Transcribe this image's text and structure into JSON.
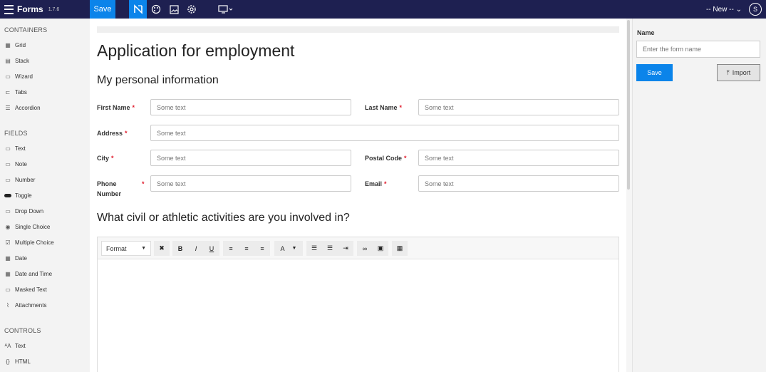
{
  "app": {
    "name": "Forms",
    "version": "1.7.6"
  },
  "topbar": {
    "save_label": "Save",
    "form_selector": "-- New --",
    "avatar_initial": "S"
  },
  "sidebar": {
    "containers_title": "CONTAINERS",
    "containers": [
      {
        "label": "Grid",
        "icon": "grid-icon"
      },
      {
        "label": "Stack",
        "icon": "stack-icon"
      },
      {
        "label": "Wizard",
        "icon": "wizard-icon"
      },
      {
        "label": "Tabs",
        "icon": "tabs-icon"
      },
      {
        "label": "Accordion",
        "icon": "accordion-icon"
      }
    ],
    "fields_title": "FIELDS",
    "fields": [
      {
        "label": "Text",
        "icon": "text-field-icon"
      },
      {
        "label": "Note",
        "icon": "note-icon"
      },
      {
        "label": "Number",
        "icon": "number-icon"
      },
      {
        "label": "Toggle",
        "icon": "toggle-icon"
      },
      {
        "label": "Drop Down",
        "icon": "dropdown-icon"
      },
      {
        "label": "Single Choice",
        "icon": "radio-icon"
      },
      {
        "label": "Multiple Choice",
        "icon": "checkbox-icon"
      },
      {
        "label": "Date",
        "icon": "calendar-icon"
      },
      {
        "label": "Date and Time",
        "icon": "datetime-icon"
      },
      {
        "label": "Masked Text",
        "icon": "masked-text-icon"
      },
      {
        "label": "Attachments",
        "icon": "paperclip-icon"
      }
    ],
    "controls_title": "CONTROLS",
    "controls": [
      {
        "label": "Text",
        "icon": "text-control-icon"
      },
      {
        "label": "HTML",
        "icon": "html-icon"
      }
    ]
  },
  "form": {
    "title": "Application for employment",
    "section1": "My personal information",
    "fields": {
      "first_name": {
        "label": "First Name",
        "placeholder": "Some text"
      },
      "last_name": {
        "label": "Last Name",
        "placeholder": "Some text"
      },
      "address": {
        "label": "Address",
        "placeholder": "Some text"
      },
      "city": {
        "label": "City",
        "placeholder": "Some text"
      },
      "postal_code": {
        "label": "Postal Code",
        "placeholder": "Some text"
      },
      "phone_line1": "Phone",
      "phone_line2": "Number",
      "phone": {
        "placeholder": "Some text"
      },
      "email": {
        "label": "Email",
        "placeholder": "Some text"
      }
    },
    "required_mark": "*",
    "section2": "What civil or athletic activities are you involved in?",
    "editor": {
      "format_label": "Format",
      "bold": "B",
      "italic": "I",
      "underline": "U",
      "font_color": "A"
    }
  },
  "properties": {
    "name_label": "Name",
    "name_placeholder": "Enter the form name",
    "save_label": "Save",
    "import_label": "Import"
  },
  "colors": {
    "topbar": "#1e2051",
    "accent": "#0b84ea",
    "required": "#e01e2e"
  }
}
